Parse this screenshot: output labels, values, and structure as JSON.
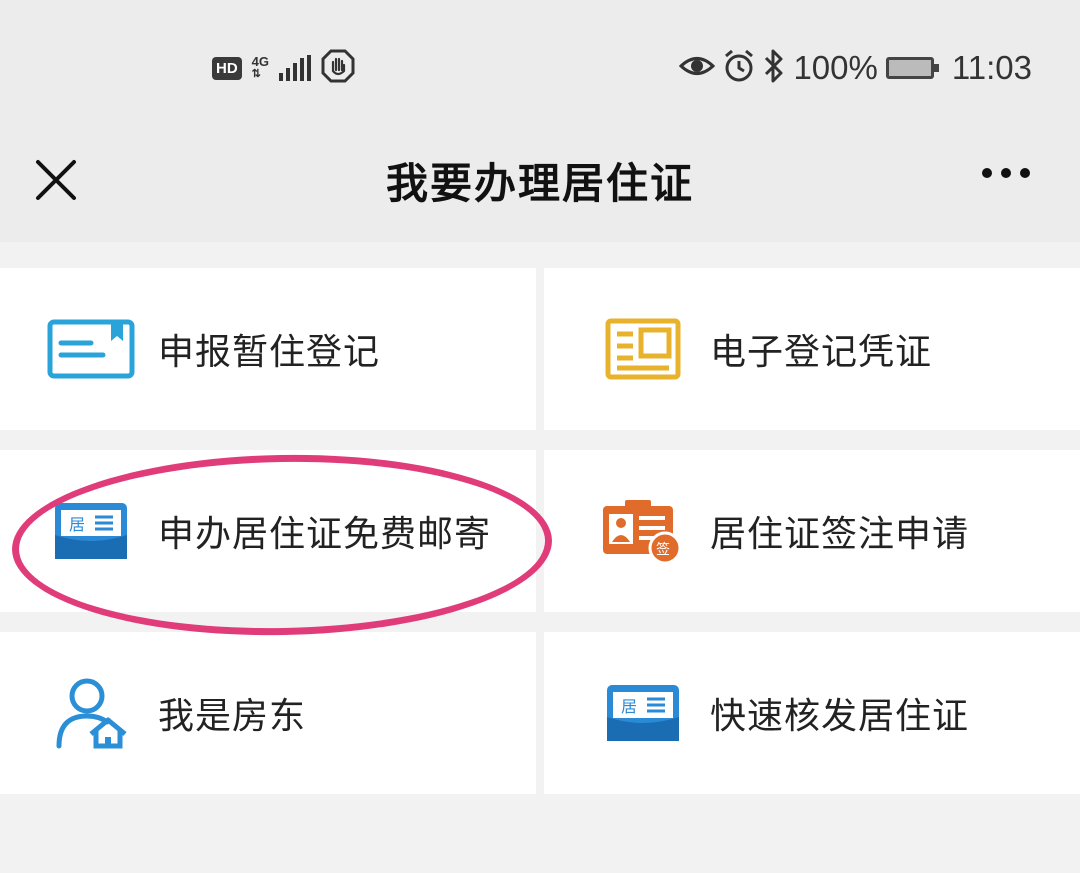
{
  "status_bar": {
    "hd": "HD",
    "network": "4G",
    "battery_percent": "100%",
    "time": "11:03",
    "icons": [
      "hd-icon",
      "4g-icon",
      "signal-icon",
      "hand-icon",
      "eye-icon",
      "alarm-icon",
      "bluetooth-icon",
      "battery-icon"
    ]
  },
  "header": {
    "title": "我要办理居住证",
    "close_icon": "close-icon",
    "more_icon": "more-icon"
  },
  "services": [
    {
      "label": "申报暂住登记",
      "icon": "registration-card-icon",
      "color": "#2aa3d8"
    },
    {
      "label": "电子登记凭证",
      "icon": "certificate-icon",
      "color": "#e8b22c"
    },
    {
      "label": "申办居住证免费邮寄",
      "icon": "residence-card-icon",
      "color": "#2b8ad6"
    },
    {
      "label": "居住证签注申请",
      "icon": "sign-id-icon",
      "color": "#e06b2a"
    },
    {
      "label": "我是房东",
      "icon": "landlord-icon",
      "color": "#2a8fd6"
    },
    {
      "label": "快速核发居住证",
      "icon": "residence-card-icon",
      "color": "#2b8ad6"
    }
  ],
  "highlight_color": "#e03c7a"
}
